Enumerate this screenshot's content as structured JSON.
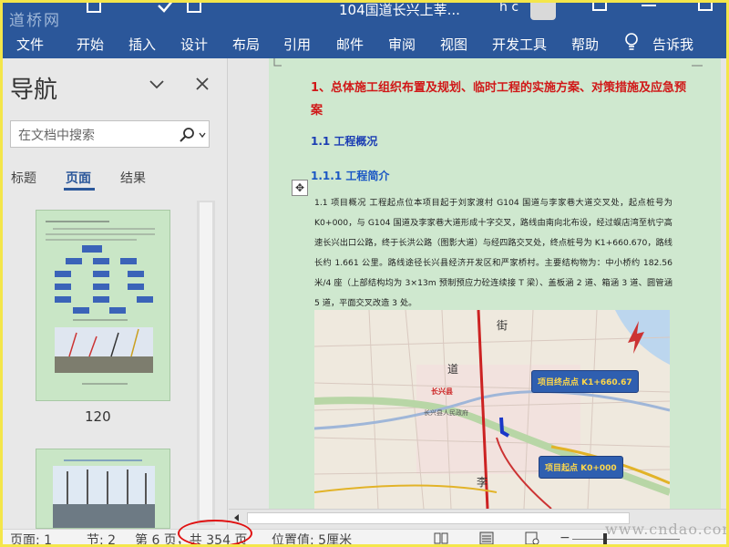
{
  "titlebar": {
    "logo": "道桥网",
    "doc_title": "104国道长兴上莘...",
    "user_name": "h c"
  },
  "ribbon": {
    "tabs": [
      "文件",
      "开始",
      "插入",
      "设计",
      "布局",
      "引用",
      "邮件",
      "审阅",
      "视图",
      "开发工具",
      "帮助"
    ],
    "tell_me": "告诉我"
  },
  "nav": {
    "title": "导航",
    "search_placeholder": "在文档中搜索",
    "tabs": [
      "标题",
      "页面",
      "结果"
    ],
    "active_tab": "页面",
    "thumb_page_number": "120"
  },
  "doc": {
    "heading1": "1、总体施工组织布置及规划、临时工程的实施方案、对策措施及应急预案",
    "heading2": "1.1 工程概况",
    "heading3": "1.1.1 工程简介",
    "paragraph": "1.1 项目概况 工程起点位本项目起于刘家渡村 G104 国道与李家巷大道交叉处，起点桩号为 K0+000，与 G104 国道及李家巷大道形成十字交叉，路线由南向北布设，经过蜈店湾至杭宁高速长兴出口公路，终于长洪公路（图影大道）与经四路交叉处，终点桩号为 K1+660.670，路线长约 1.661 公里。路线途径长兴县经济开发区和严家桥村。主要结构物为：中小桥约 182.56 米/4 座（上部结构均为 3×13m 预制预应力砼连续接 T 梁）、盖板涵 2 道、箱涵 3 道、圆管涵 5 道，平面交叉改造 3 处。",
    "map": {
      "callout_end": "项目终点点 K1+660.67",
      "callout_start": "项目起点 K0+000",
      "label_changxing": "长兴县",
      "label_changxing_road": "长兴县人民政府",
      "label_street": "街",
      "label_road": "道",
      "label_li": "李"
    }
  },
  "status": {
    "page": "页面: 1",
    "section": "节: 2",
    "page_of": "第 6 页，共 354 页",
    "position": "位置值: 5厘米"
  },
  "watermark_url": "www.cndao.com"
}
